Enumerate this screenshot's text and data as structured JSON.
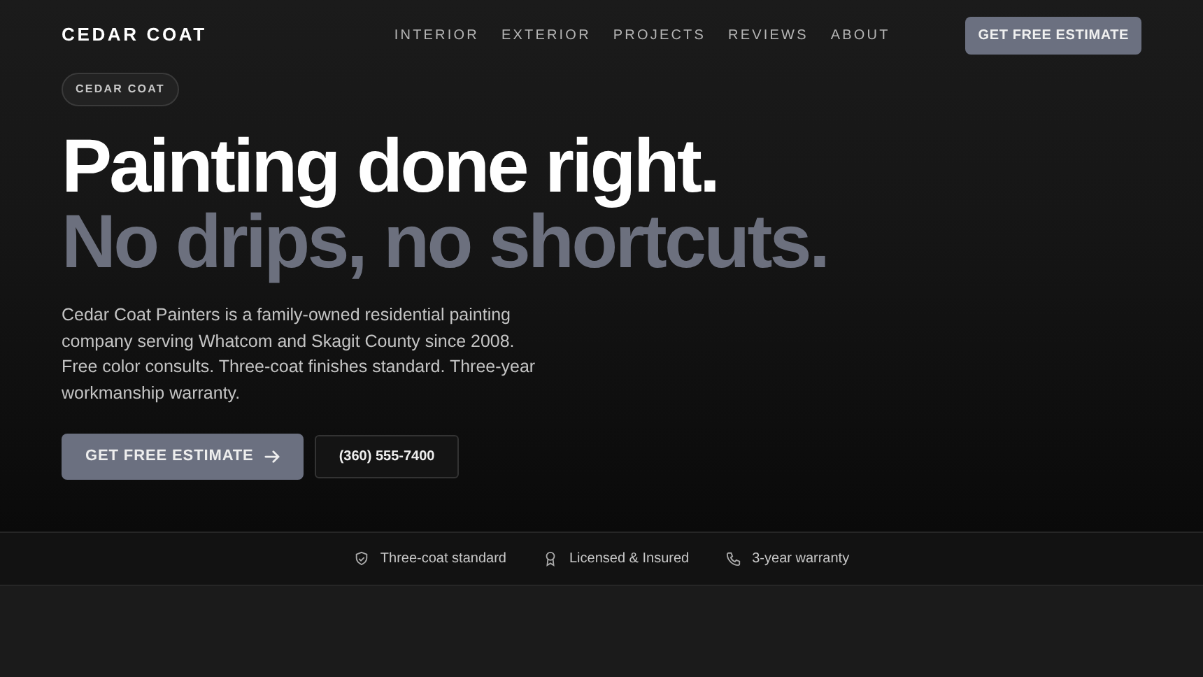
{
  "brand": "CEDAR COAT",
  "nav": [
    {
      "label": "INTERIOR"
    },
    {
      "label": "EXTERIOR"
    },
    {
      "label": "PROJECTS"
    },
    {
      "label": "REVIEWS"
    },
    {
      "label": "ABOUT"
    }
  ],
  "nav_cta": "GET FREE ESTIMATE",
  "hero": {
    "badge": "CEDAR COAT",
    "headline": "Painting done right.",
    "subheadline": "No drips, no shortcuts.",
    "body": "Cedar Coat Painters is a family-owned residential painting company serving Whatcom and Skagit County since 2008. Free color consults. Three-coat finishes standard. Three-year workmanship warranty.",
    "primary_button": "GET FREE ESTIMATE",
    "secondary_button": "(360) 555-7400"
  },
  "trust": [
    {
      "kind": "shield",
      "label": "Three-coat standard"
    },
    {
      "kind": "award",
      "label": "Licensed & Insured"
    },
    {
      "kind": "phone",
      "label": "3-year warranty"
    }
  ]
}
